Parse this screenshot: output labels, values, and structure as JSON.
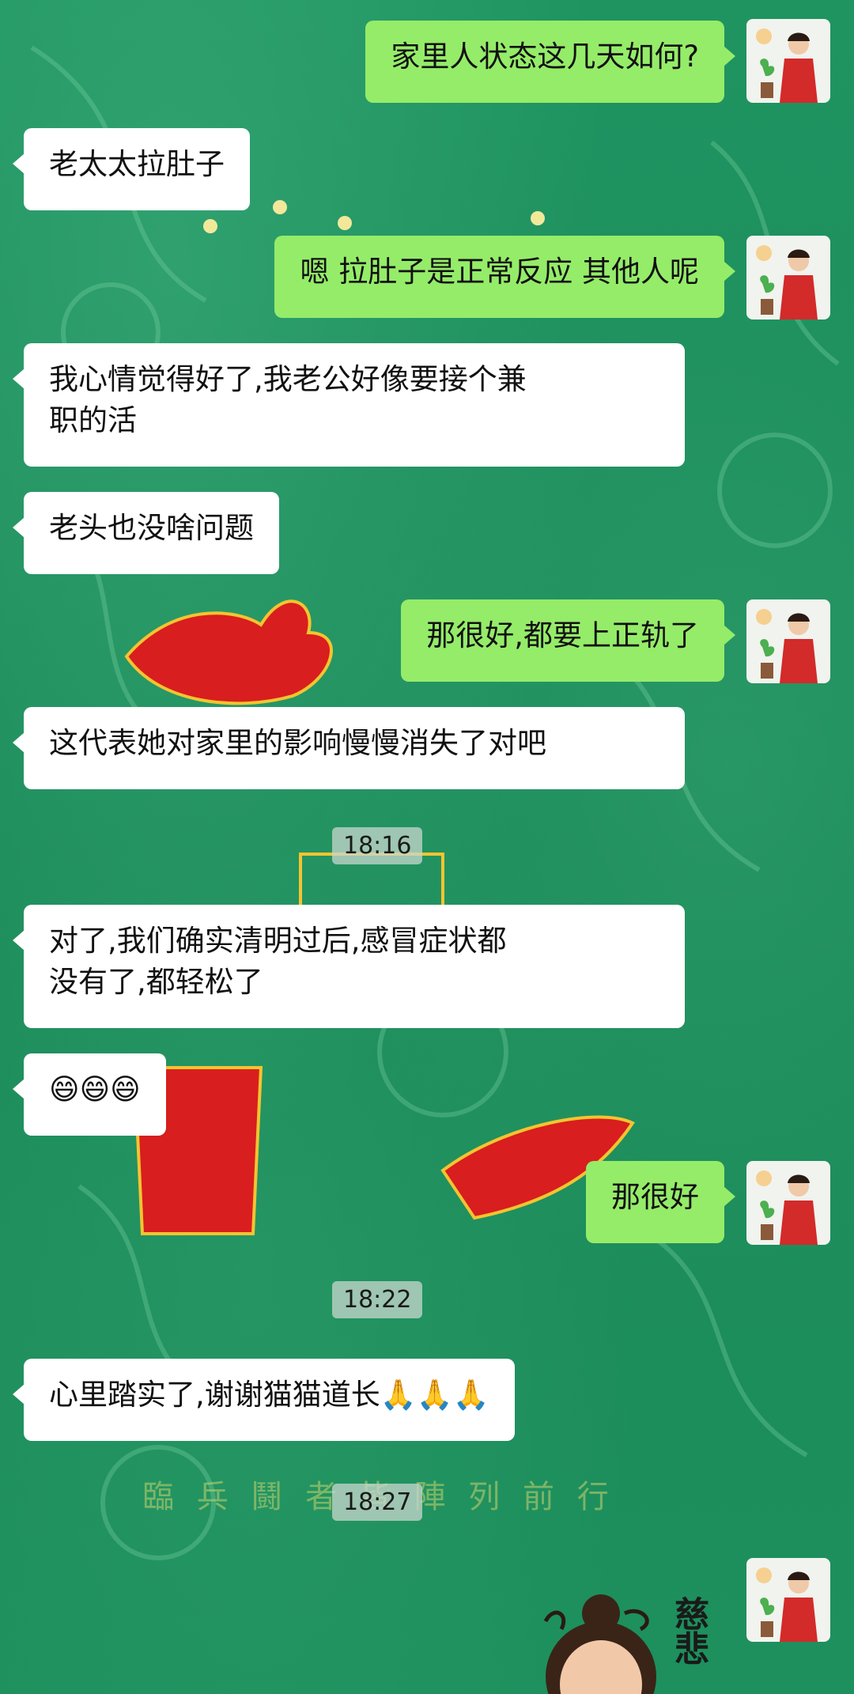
{
  "messages": [
    {
      "side": "right",
      "text": "家里人状态这几天如何?"
    },
    {
      "side": "left",
      "text": "老太太拉肚子"
    },
    {
      "side": "right",
      "text": "嗯 拉肚子是正常反应 其他人呢"
    },
    {
      "side": "left",
      "text": "我心情觉得好了,我老公好像要接个兼\n职的活"
    },
    {
      "side": "left",
      "text": "老头也没啥问题"
    },
    {
      "side": "right",
      "text": "那很好,都要上正轨了"
    },
    {
      "side": "left",
      "text": "这代表她对家里的影响慢慢消失了对吧"
    },
    {
      "side": "left",
      "text": "对了,我们确实清明过后,感冒症状都\n没有了,都轻松了"
    },
    {
      "side": "left",
      "text": "😄😄😄"
    },
    {
      "side": "right",
      "text": "那很好"
    },
    {
      "side": "left",
      "text": "心里踏实了,谢谢猫猫道长🙏🙏🙏"
    }
  ],
  "timestamps": [
    "18:16",
    "18:22",
    "18:27"
  ],
  "background_text": {
    "motto": "臨 兵 鬪 者 皆 陣 列 前 行",
    "sticker_text": "慈悲"
  },
  "colors": {
    "background": "#1e8f5e",
    "bubble_right": "#95ec69",
    "bubble_left": "#ffffff",
    "seal_red": "#d81e1e"
  }
}
